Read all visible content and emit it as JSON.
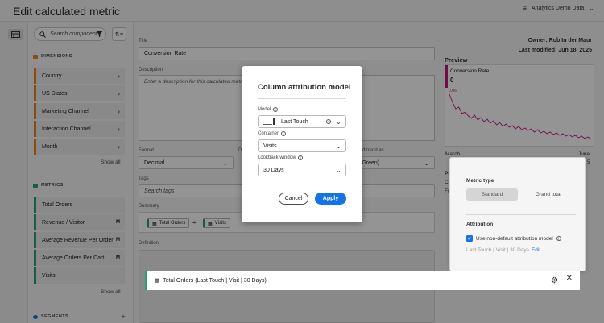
{
  "header": {
    "title": "Edit calculated metric",
    "org": "Analytics Demo Data"
  },
  "left_panel": {
    "search_placeholder": "Search component",
    "dimensions_heading": "DIMENSIONS",
    "dimensions": [
      "Country",
      "US States",
      "Marketing Channel",
      "Interaction Channel",
      "Month"
    ],
    "metrics_heading": "METRICS",
    "metrics": [
      "Total Orders",
      "Revenue / Visitor",
      "Average Revenue Per Order",
      "Average Orders Per Cart",
      "Visits"
    ],
    "metric_badge": "M",
    "show_all": "Show all",
    "segments_heading": "SEGMENTS"
  },
  "form": {
    "title_label": "Title",
    "title_value": "Conversion Rate",
    "description_label": "Description",
    "description_placeholder": "Enter a description for this calculated metric",
    "format_label": "Format",
    "format_value": "Decimal",
    "format_col2_label": "D",
    "trend_label": "d trend as",
    "trend_value": "(Green)",
    "tags_label": "Tags",
    "tags_placeholder": "Search tags",
    "summary_label": "Summary",
    "summary_chip1": "Total Orders",
    "summary_op": "÷",
    "summary_chip2": "Visits",
    "definition_label": "Definition",
    "definition_item": "Total Orders (Last Touch | Visit | 30 Days)",
    "definition_op": "÷"
  },
  "meta": {
    "owner": "Owner: Rob In der Maur",
    "modified": "Last modified: Jun 18, 2025"
  },
  "preview": {
    "heading": "Preview",
    "metric_name": "Conversion Rate",
    "value": "0",
    "axis_top": "0.06",
    "x_start": "March",
    "x_end": "June",
    "x_end_sub": "5",
    "side_pr": "Pr",
    "side_cu": "Cu",
    "side_fu": "Fu"
  },
  "chart_data": {
    "type": "line",
    "series": [
      {
        "values": [
          0.06,
          0.05,
          0.042,
          0.044,
          0.036,
          0.038,
          0.033,
          0.03,
          0.034,
          0.028,
          0.031,
          0.026,
          0.029,
          0.024,
          0.027,
          0.022,
          0.025,
          0.02,
          0.023,
          0.019,
          0.021,
          0.017,
          0.02,
          0.016,
          0.018,
          0.015,
          0.017,
          0.013,
          0.016,
          0.012,
          0.014,
          0.011,
          0.013,
          0.01,
          0.012,
          0.009,
          0.011,
          0.008,
          0.01,
          0.007,
          0.009,
          0.006,
          0.008,
          0.005,
          0.007,
          0.004
        ]
      }
    ],
    "ylim": [
      0,
      0.06
    ],
    "color": "#c2187c"
  },
  "modal": {
    "title": "Column attribution model",
    "model_label": "Model",
    "model_value": "Last Touch",
    "container_label": "Container",
    "container_value": "Visits",
    "lookback_label": "Lookback window",
    "lookback_value": "30 Days",
    "cancel": "Cancel",
    "apply": "Apply"
  },
  "popover": {
    "metric_type_label": "Metric type",
    "standard": "Standard",
    "grand_total": "Grand total",
    "attribution_label": "Attribution",
    "checkbox_label": "Use non-default attribution model",
    "attribution_summary": "Last Touch | Visit | 30 Days",
    "edit_link": "Edit"
  },
  "colors": {
    "accent": "#1473e6",
    "dimension": "#e68619",
    "metric": "#2d9d78",
    "series": "#c2187c"
  }
}
